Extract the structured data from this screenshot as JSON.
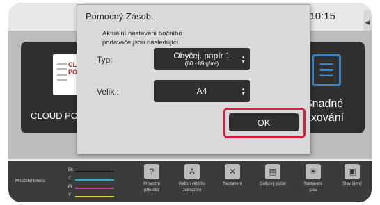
{
  "status": {
    "clock": "10:15"
  },
  "home": {
    "tile_left": {
      "label": "CLOUD POR",
      "icon_text_line1": "CLOUD",
      "icon_text_line2": "PORTAL"
    },
    "tile_right": {
      "label_line1": "Snadné",
      "label_line2": "axování"
    }
  },
  "bottom": {
    "toner_label": "Množství toneru",
    "toner": [
      {
        "name": "Bk",
        "color": "#111111"
      },
      {
        "name": "C",
        "color": "#1fb5d6"
      },
      {
        "name": "M",
        "color": "#c03a9a"
      },
      {
        "name": "Y",
        "color": "#e3d126"
      }
    ],
    "shortcuts": [
      {
        "line1": "Provozní",
        "line2": "příručka",
        "icon": "manual-icon"
      },
      {
        "line1": "Režim většího",
        "line2": "zobrazení",
        "icon": "large-text-icon"
      },
      {
        "line1": "Nastavení",
        "line2": "",
        "icon": "tools-icon"
      },
      {
        "line1": "Celkový počet",
        "line2": "",
        "icon": "counter-icon"
      },
      {
        "line1": "Nastavení",
        "line2": "jasu",
        "icon": "brightness-icon"
      },
      {
        "line1": "Stav úlohy",
        "line2": "",
        "icon": "job-status-icon"
      }
    ]
  },
  "dialog": {
    "title": "Pomocný Zásob.",
    "message_line1": "Aktuální nastavení bočního",
    "message_line2": "podavače jsou následující.",
    "type_label": "Typ:",
    "type_value": "Obyčej. papír 1",
    "type_sub": "(60 - 89 g/m²)",
    "size_label": "Velik.:",
    "size_value": "A4",
    "ok_label": "OK",
    "highlight_color": "#d41f3e"
  }
}
